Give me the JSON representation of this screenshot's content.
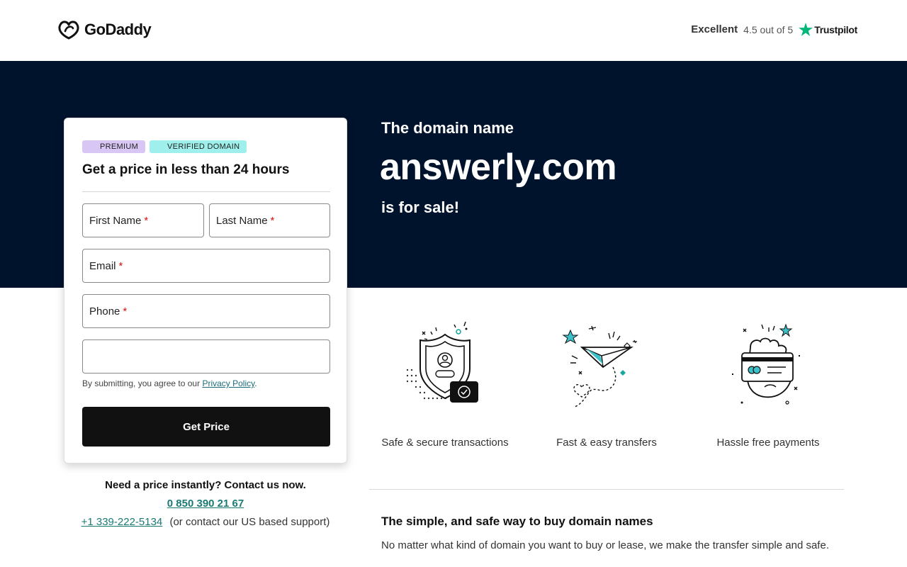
{
  "header": {
    "brand": "GoDaddy",
    "trust_label": "Excellent",
    "trust_rating": "4.5 out of 5",
    "trust_brand": "Trustpilot"
  },
  "hero": {
    "subtitle": "The domain name",
    "domain": "answerly.com",
    "tagline": "is for sale!"
  },
  "form": {
    "badges": [
      "PREMIUM",
      "VERIFIED DOMAIN"
    ],
    "title": "Get a price in less than 24 hours",
    "first_name": "First Name",
    "last_name": "Last Name",
    "email": "Email",
    "phone": "Phone",
    "required_mark": "*",
    "disclaimer": "By submitting, you agree to our",
    "privacy_link": "Privacy Policy",
    "disclaimer_end": ".",
    "submit": "Get Price"
  },
  "contact": {
    "question": "Need a price instantly? Contact us now.",
    "phone_local": "0 850 390 21 67",
    "phone_us": "+1 339-222-5134",
    "us_note": "(or contact our US based support)"
  },
  "features": [
    {
      "label": "Safe & secure transactions",
      "icon": "shield-icon"
    },
    {
      "label": "Fast & easy transfers",
      "icon": "paper-plane-icon"
    },
    {
      "label": "Hassle free payments",
      "icon": "card-payment-icon"
    }
  ],
  "info": {
    "title": "The simple, and safe way to buy domain names",
    "text": "No matter what kind of domain you want to buy or lease, we make the transfer simple and safe."
  },
  "colors": {
    "hero_bg": "#00132c",
    "accent_teal": "#1b7a74",
    "premium_badge": "#d8c7f5",
    "verified_badge": "#9ff0ec",
    "trustpilot_star": "#00b67a"
  }
}
